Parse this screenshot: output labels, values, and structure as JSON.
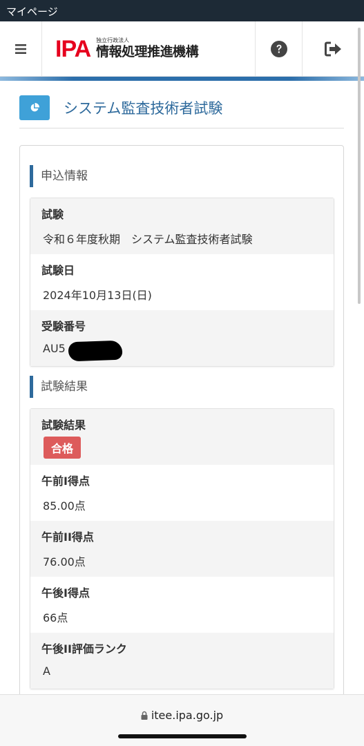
{
  "titlebar": {
    "title": "マイページ"
  },
  "header": {
    "logo_mark": "IPA",
    "logo_subtitle": "独立行政法人",
    "logo_name": "情報処理推進機構",
    "icons": {
      "menu": "menu-icon",
      "help": "help-icon",
      "logout": "logout-icon"
    }
  },
  "page": {
    "icon": "pie-chart-icon",
    "title": "システム監査技術者試験"
  },
  "application": {
    "heading": "申込情報",
    "rows": [
      {
        "label": "試験",
        "value": "令和６年度秋期　システム監査技術者試験"
      },
      {
        "label": "試験日",
        "value": "2024年10月13日(日)"
      },
      {
        "label": "受験番号",
        "value": "AU5"
      }
    ]
  },
  "results": {
    "heading": "試験結果",
    "status_label": "試験結果",
    "status_badge": "合格",
    "rows": [
      {
        "label": "午前I得点",
        "value": "85.00点"
      },
      {
        "label": "午前II得点",
        "value": "76.00点"
      },
      {
        "label": "午後I得点",
        "value": "66点"
      },
      {
        "label": "午後II評価ランク",
        "value": "A"
      }
    ]
  },
  "browser": {
    "url": "itee.ipa.go.jp",
    "icon": "lock-icon"
  },
  "colors": {
    "titlebar": "#1d2a36",
    "brand_red": "#e6001e",
    "accent_blue": "#2e6a9c",
    "icon_blue": "#3fa1d8",
    "pass_badge": "#dd5b5b"
  }
}
